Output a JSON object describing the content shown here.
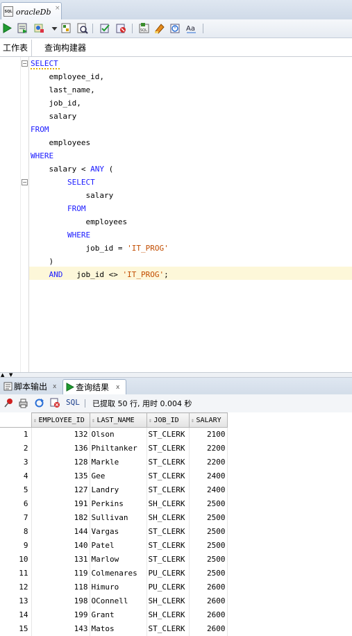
{
  "doc_tab": {
    "title": "oracleDb",
    "close": "×"
  },
  "toolbar": {
    "icons": [
      "run-statement-icon",
      "run-script-icon",
      "autotrace-icon",
      "dropdown-arrow-icon",
      "explain-plan-icon",
      "sql-tuning-icon",
      "commit-icon",
      "rollback-icon",
      "unshared-sql-icon",
      "clear-icon",
      "sql-history-icon",
      "format-case-icon"
    ]
  },
  "subtabs": {
    "worksheet": "工作表",
    "query_builder": "查询构建器"
  },
  "editor": {
    "lines": [
      {
        "indent": "",
        "parts": [
          {
            "t": "SELECT",
            "k": "kw"
          }
        ]
      },
      {
        "indent": "    ",
        "parts": [
          {
            "t": "employee_id,",
            "k": ""
          }
        ]
      },
      {
        "indent": "    ",
        "parts": [
          {
            "t": "last_name,",
            "k": ""
          }
        ]
      },
      {
        "indent": "    ",
        "parts": [
          {
            "t": "job_id,",
            "k": ""
          }
        ]
      },
      {
        "indent": "    ",
        "parts": [
          {
            "t": "salary",
            "k": ""
          }
        ]
      },
      {
        "indent": "",
        "parts": [
          {
            "t": "FROM",
            "k": "kw"
          }
        ]
      },
      {
        "indent": "    ",
        "parts": [
          {
            "t": "employees",
            "k": ""
          }
        ]
      },
      {
        "indent": "",
        "parts": [
          {
            "t": "WHERE",
            "k": "kw"
          }
        ]
      },
      {
        "indent": "    ",
        "parts": [
          {
            "t": "salary < ",
            "k": ""
          },
          {
            "t": "ANY",
            "k": "kw"
          },
          {
            "t": " (",
            "k": ""
          }
        ]
      },
      {
        "indent": "        ",
        "parts": [
          {
            "t": "SELECT",
            "k": "kw"
          }
        ]
      },
      {
        "indent": "            ",
        "parts": [
          {
            "t": "salary",
            "k": ""
          }
        ]
      },
      {
        "indent": "        ",
        "parts": [
          {
            "t": "FROM",
            "k": "kw"
          }
        ]
      },
      {
        "indent": "            ",
        "parts": [
          {
            "t": "employees",
            "k": ""
          }
        ]
      },
      {
        "indent": "        ",
        "parts": [
          {
            "t": "WHERE",
            "k": "kw"
          }
        ]
      },
      {
        "indent": "            ",
        "parts": [
          {
            "t": "job_id = ",
            "k": ""
          },
          {
            "t": "'IT_PROG'",
            "k": "str"
          }
        ]
      },
      {
        "indent": "    ",
        "parts": [
          {
            "t": ")",
            "k": ""
          }
        ]
      },
      {
        "indent": "    ",
        "parts": [
          {
            "t": "AND",
            "k": "kw"
          },
          {
            "t": "   job_id <> ",
            "k": ""
          },
          {
            "t": "'IT_PROG'",
            "k": "str"
          },
          {
            "t": ";",
            "k": ""
          }
        ]
      }
    ]
  },
  "bottom_tabs": {
    "script_output": "脚本输出",
    "query_result": "查询结果",
    "close": "x"
  },
  "result_toolbar": {
    "sql_label": "SQL",
    "status": "已提取 50 行, 用时 0.004 秒"
  },
  "grid": {
    "columns": [
      "EMPLOYEE_ID",
      "LAST_NAME",
      "JOB_ID",
      "SALARY"
    ],
    "rows": [
      [
        "1",
        "132",
        "Olson",
        "ST_CLERK",
        "2100"
      ],
      [
        "2",
        "136",
        "Philtanker",
        "ST_CLERK",
        "2200"
      ],
      [
        "3",
        "128",
        "Markle",
        "ST_CLERK",
        "2200"
      ],
      [
        "4",
        "135",
        "Gee",
        "ST_CLERK",
        "2400"
      ],
      [
        "5",
        "127",
        "Landry",
        "ST_CLERK",
        "2400"
      ],
      [
        "6",
        "191",
        "Perkins",
        "SH_CLERK",
        "2500"
      ],
      [
        "7",
        "182",
        "Sullivan",
        "SH_CLERK",
        "2500"
      ],
      [
        "8",
        "144",
        "Vargas",
        "ST_CLERK",
        "2500"
      ],
      [
        "9",
        "140",
        "Patel",
        "ST_CLERK",
        "2500"
      ],
      [
        "10",
        "131",
        "Marlow",
        "ST_CLERK",
        "2500"
      ],
      [
        "11",
        "119",
        "Colmenares",
        "PU_CLERK",
        "2500"
      ],
      [
        "12",
        "118",
        "Himuro",
        "PU_CLERK",
        "2600"
      ],
      [
        "13",
        "198",
        "OConnell",
        "SH_CLERK",
        "2600"
      ],
      [
        "14",
        "199",
        "Grant",
        "SH_CLERK",
        "2600"
      ],
      [
        "15",
        "143",
        "Matos",
        "ST_CLERK",
        "2600"
      ]
    ]
  }
}
